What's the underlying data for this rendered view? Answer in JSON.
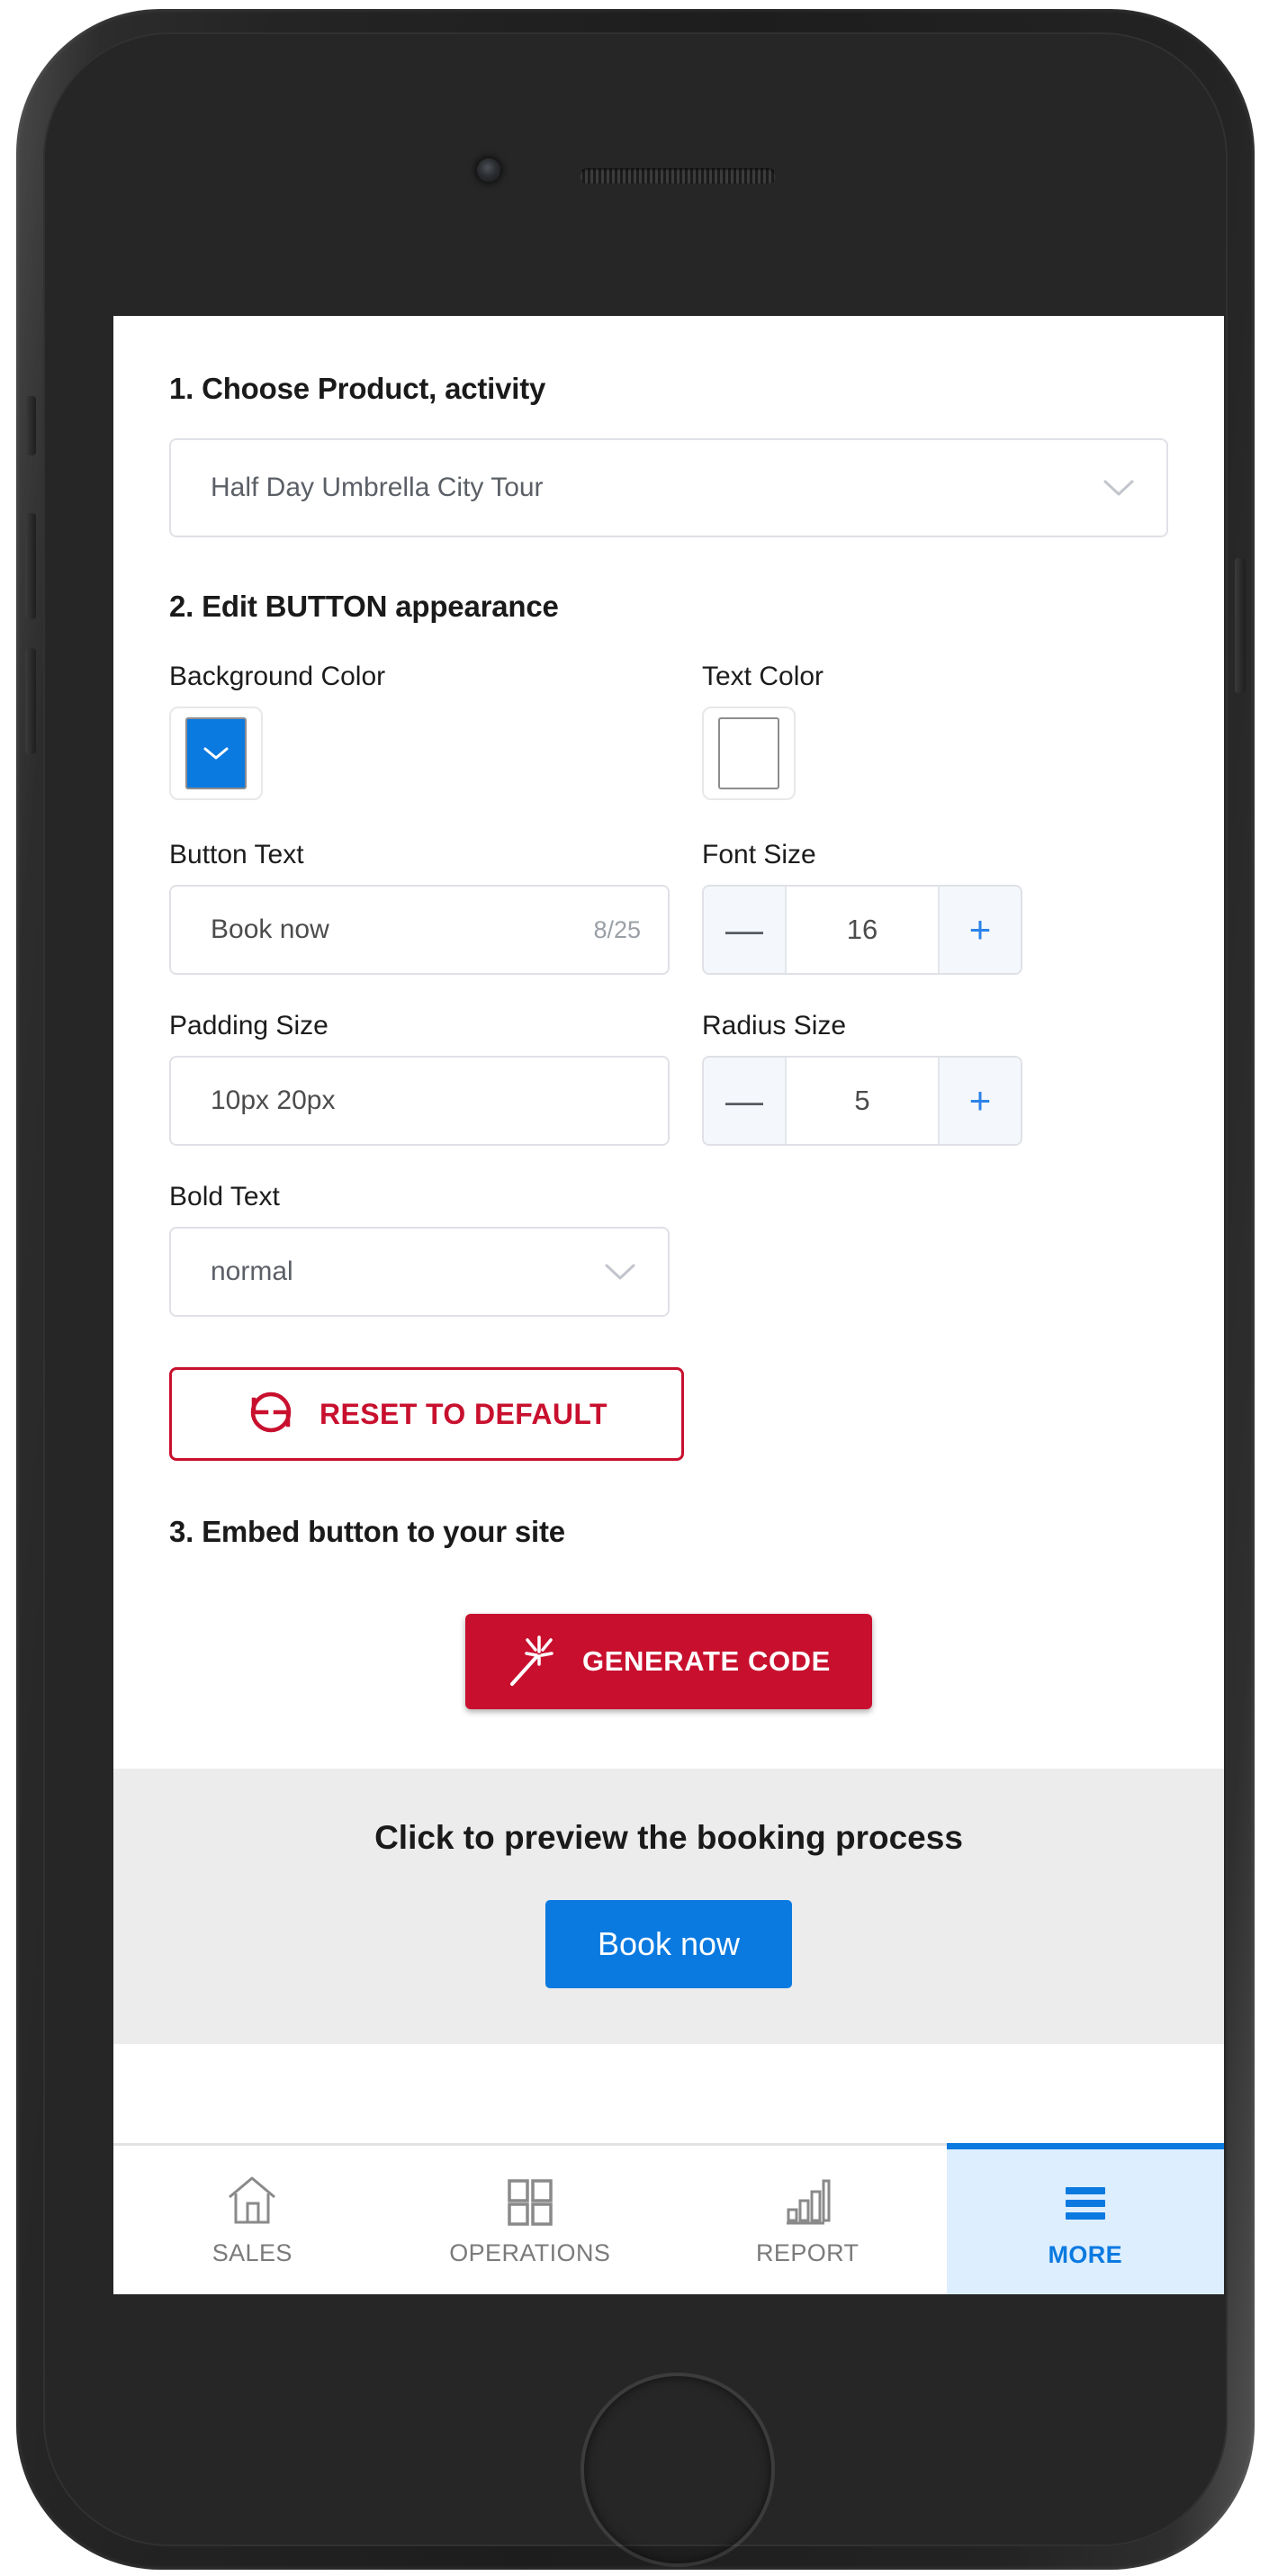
{
  "device": {
    "camera_icon": "camera-icon",
    "speaker_icon": "speaker-grille-icon",
    "home_button_icon": "home-button"
  },
  "form": {
    "step1": {
      "title": "1. Choose Product, activity",
      "product_select": {
        "value": "Half Day Umbrella City Tour",
        "chevron_icon": "chevron-down-icon"
      }
    },
    "step2": {
      "title": "2. Edit BUTTON appearance",
      "background_color": {
        "label": "Background Color",
        "value": "#0a7ae0",
        "chevron_icon": "chevron-down-icon"
      },
      "text_color": {
        "label": "Text Color",
        "value": "#ffffff"
      },
      "button_text": {
        "label": "Button Text",
        "value": "Book now",
        "counter": "8/25"
      },
      "font_size": {
        "label": "Font Size",
        "value": "16",
        "minus": "—",
        "plus": "+"
      },
      "padding_size": {
        "label": "Padding Size",
        "value": "10px 20px"
      },
      "radius_size": {
        "label": "Radius Size",
        "value": "5",
        "minus": "—",
        "plus": "+"
      },
      "bold_text": {
        "label": "Bold Text",
        "value": "normal",
        "chevron_icon": "chevron-down-icon"
      },
      "reset_button": {
        "label": "RESET TO DEFAULT",
        "icon": "refresh-rotate-icon",
        "color": "#c8102e"
      }
    },
    "step3": {
      "title": "3. Embed button to your site",
      "generate_button": {
        "label": "GENERATE CODE",
        "icon": "magic-wand-icon",
        "color": "#c8102e"
      }
    }
  },
  "preview": {
    "title": "Click to preview the booking process",
    "book_button": {
      "label": "Book now",
      "background": "#0a7ae0",
      "text_color": "#ffffff"
    }
  },
  "bottom_nav": {
    "items": [
      {
        "label": "SALES",
        "icon": "house-icon",
        "active": false
      },
      {
        "label": "OPERATIONS",
        "icon": "grid-icon",
        "active": false
      },
      {
        "label": "REPORT",
        "icon": "bar-chart-icon",
        "active": false
      },
      {
        "label": "MORE",
        "icon": "hamburger-icon",
        "active": true
      }
    ],
    "active_color": "#0a7ae0"
  }
}
